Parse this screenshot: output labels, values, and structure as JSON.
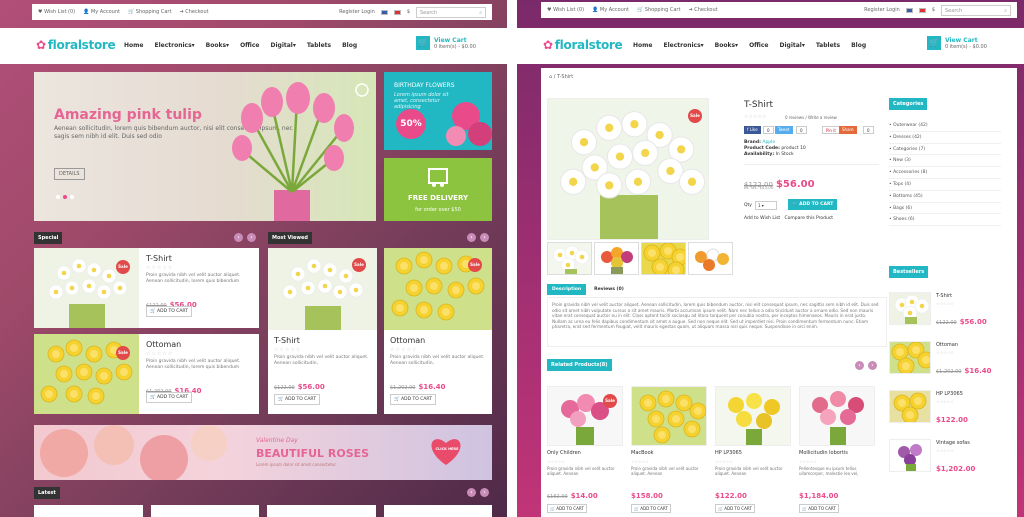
{
  "topbar": {
    "wishlist": "Wish List (0)",
    "account": "My Account",
    "cart": "Shopping Cart",
    "checkout": "Checkout",
    "register": "Register Login",
    "currency": "$",
    "search_placeholder": "Search"
  },
  "logo": {
    "text": "floralstore"
  },
  "nav": [
    "Home",
    "Electronics▾",
    "Books▾",
    "Office",
    "Digital▾",
    "Tablets",
    "Blog"
  ],
  "cart": {
    "title": "View Cart",
    "items": "0 item(s) - $0.00"
  },
  "left": {
    "hero": {
      "title": "Amazing pink tulip",
      "text": "Aenean sollicitudin, lorem quis bibendum auctor, nisi elit consequat ipsum, nec sagis sem nibh id elit. Duis sed odio",
      "button": "DETAILS"
    },
    "birthday": {
      "title": "BIRTHDAY FLOWERS",
      "sub": "Lorem ipsum dolor sit amet, consectetur adipisicing",
      "badge": "50%"
    },
    "delivery": {
      "title": "FREE DELIVERY",
      "sub": "for order over $50"
    },
    "special_label": "Special",
    "mostviewed_label": "Most Viewed",
    "latest_label": "Latest",
    "products": [
      {
        "name": "T-Shirt",
        "desc": "Proin gravida nibh vel velit auctor aliquet. Aenean sollicitudin, lorem quis bibendum",
        "old": "$122.00",
        "new": "$56.00",
        "btn": "ADD TO CART",
        "sale": "Sale"
      },
      {
        "name": "Ottoman",
        "desc": "Proin gravida nibh vel velit auctor aliquet. Aenean sollicitudin, lorem quis bibendum",
        "old": "$1,202.00",
        "new": "$16.40",
        "btn": "ADD TO CART",
        "sale": "Sale"
      },
      {
        "name": "T-Shirt",
        "desc": "Proin gravida nibh vel velit auctor aliquet. Aenean sollicitudin,",
        "old": "$122.00",
        "new": "$56.00",
        "btn": "ADD TO CART",
        "sale": "Sale"
      },
      {
        "name": "Ottoman",
        "desc": "Proin gravida nibh vel velit auctor aliquet. Aenean sollicitudin,",
        "old": "$1,202.00",
        "new": "$16.40",
        "btn": "ADD TO CART",
        "sale": "Sale"
      }
    ],
    "banner": {
      "sub": "Valentine Day",
      "title": "BEAUTIFUL ROSES",
      "text": "Lorem ipsum dolor sit amet consectetur",
      "heart": "CLICK HERE"
    }
  },
  "right": {
    "breadcrumb": "⌂ / T-Shirt",
    "title": "T-Shirt",
    "reviews": "0 reviews / Write a review",
    "social": {
      "like": "Like",
      "tweet": "Tweet",
      "pin": "Pin it",
      "share": "Share"
    },
    "brand_label": "Brand:",
    "brand": "Apple",
    "code_label": "Product Code:",
    "code": "product 10",
    "avail_label": "Availability:",
    "avail": "In Stock",
    "old": "$122.00",
    "new": "$56.00",
    "extax": "Ex Tax: $45.00",
    "qty_label": "Qty",
    "qty": "1",
    "add": "ADD TO CART",
    "wish": "Add to Wish List",
    "compare": "Compare this Product",
    "tabs": [
      "Description",
      "Reviews (0)"
    ],
    "desc": "Proin gravida nibh vel velit auctor aliquet. Aenean sollicitudin, lorem quis bibendum auctor, nisi elit consequat ipsum, nec sagittis sem nibh id elit. Duis sed odio sit amet nibh vulputate cursus a sit amet mauris. Morbi accumsan ipsum velit. Nam nec tellus a odio tincidunt auctor a ornare odio. Sed non mauris vitae erat consequat auctor eu in elit. Class aptent taciti sociosqu ad litora torquent per conubia nostra, per inceptos himenaeos. Mauris in erat justo. Nullam ac urna eu felis dapibus condimentum sit amet a augue. Sed non neque elit. Sed ut imperdiet nisi. Proin condimentum fermentum nunc. Etiam pharetra, erat sed fermentum feugiat, velit mauris egestas quam, ut aliquam massa nisl quis neque. Suspendisse in orci enim.",
    "related_label": "Related Products(8)",
    "related": [
      {
        "name": "Only Children",
        "desc": "Proin gravida nibh vel velit auctor aliquet. Aenean",
        "old": "$162.00",
        "new": "$14.00",
        "btn": "ADD TO CART",
        "sale": "Sale"
      },
      {
        "name": "MacBook",
        "desc": "Proin gravida nibh vel velit auctor aliquet. Aenean",
        "new": "$158.00",
        "btn": "ADD TO CART"
      },
      {
        "name": "HP LP3065",
        "desc": "Proin gravida nibh vel velit auctor aliquet. Aenean",
        "new": "$122.00",
        "btn": "ADD TO CART"
      },
      {
        "name": "Mollicitudin lobortis",
        "desc": "Pellentesque eu ipsum tellus ullamcorper, molestie leo vel,",
        "new": "$1,184.00",
        "btn": "ADD TO CART"
      }
    ],
    "categories_label": "Categories",
    "categories": [
      "Outerwear (42)",
      "Dresses (42)",
      "Categories (7)",
      "New (3)",
      "Accessories (8)",
      "Tops (4)",
      "Bottoms (45)",
      "Bags (6)",
      "Shoes (6)"
    ],
    "bestsellers_label": "Bestsellers",
    "bestsellers": [
      {
        "name": "T-Shirt",
        "old": "$122.00",
        "new": "$56.00"
      },
      {
        "name": "Ottoman",
        "old": "$1,202.00",
        "new": "$16.40"
      },
      {
        "name": "HP LP3065",
        "new": "$122.00"
      },
      {
        "name": "Vintage sofas",
        "new": "$1,202.00"
      }
    ]
  },
  "colors": {
    "accent": "#21b8c3",
    "pink": "#e94b8a",
    "green": "#8cc43f",
    "sale": "#e24a4a"
  }
}
